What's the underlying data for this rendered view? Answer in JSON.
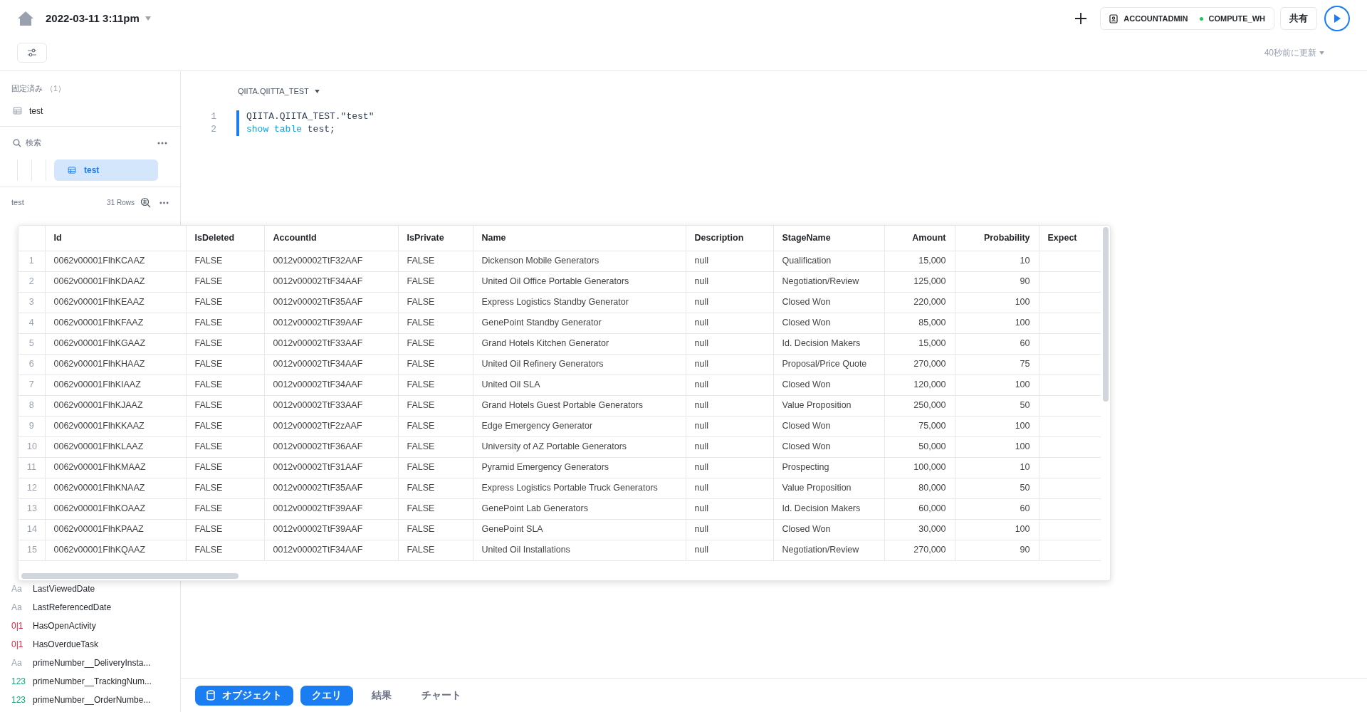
{
  "header": {
    "title": "2022-03-11 3:11pm",
    "role": "ACCOUNTADMIN",
    "warehouse": "COMPUTE_WH",
    "share": "共有",
    "updated": "40秒前に更新"
  },
  "sidebar": {
    "pinned_label": "固定済み",
    "pinned_count": "（1）",
    "pinned_items": [
      "test"
    ],
    "search": "検索",
    "tree": [
      {
        "label": "test",
        "selected": true
      }
    ],
    "table_name": "test",
    "row_count": "31 Rows",
    "columns": [
      {
        "kind": "text",
        "type_label": "Aa",
        "name": "LastViewedDate"
      },
      {
        "kind": "text",
        "type_label": "Aa",
        "name": "LastReferencedDate"
      },
      {
        "kind": "boolean",
        "type_label": "0|1",
        "name": "HasOpenActivity"
      },
      {
        "kind": "boolean",
        "type_label": "0|1",
        "name": "HasOverdueTask"
      },
      {
        "kind": "text",
        "type_label": "Aa",
        "name": "primeNumber__DeliveryInsta..."
      },
      {
        "kind": "number",
        "type_label": "123",
        "name": "primeNumber__TrackingNum..."
      },
      {
        "kind": "number",
        "type_label": "123",
        "name": "primeNumber__OrderNumbe..."
      }
    ]
  },
  "editor": {
    "schema": "QIITA.QIITTA_TEST",
    "lines": [
      {
        "number": "1",
        "tokens": [
          {
            "kind": "plain",
            "text": "QIITA.QIITA_TEST.\"test\""
          }
        ]
      },
      {
        "number": "2",
        "tokens": [
          {
            "kind": "keyword",
            "text": "show table"
          },
          {
            "kind": "plain",
            "text": " test;"
          }
        ]
      }
    ]
  },
  "table": {
    "columns": [
      {
        "kind": "index"
      },
      {
        "label": "Id",
        "kind": "text"
      },
      {
        "label": "IsDeleted",
        "kind": "text"
      },
      {
        "label": "AccountId",
        "kind": "text"
      },
      {
        "label": "IsPrivate",
        "kind": "text"
      },
      {
        "label": "Name",
        "kind": "text"
      },
      {
        "label": "Description",
        "kind": "text"
      },
      {
        "label": "StageName",
        "kind": "text"
      },
      {
        "label": "Amount",
        "kind": "number"
      },
      {
        "label": "Probability",
        "kind": "number"
      },
      {
        "label": "Expect",
        "kind": "text"
      }
    ],
    "rows": [
      [
        "1",
        "0062v00001FlhKCAAZ",
        "FALSE",
        "0012v00002TtF32AAF",
        "FALSE",
        "Dickenson Mobile Generators",
        "null",
        "Qualification",
        "15,000",
        "10"
      ],
      [
        "2",
        "0062v00001FlhKDAAZ",
        "FALSE",
        "0012v00002TtF34AAF",
        "FALSE",
        "United Oil Office Portable Generators",
        "null",
        "Negotiation/Review",
        "125,000",
        "90"
      ],
      [
        "3",
        "0062v00001FlhKEAAZ",
        "FALSE",
        "0012v00002TtF35AAF",
        "FALSE",
        "Express Logistics Standby Generator",
        "null",
        "Closed Won",
        "220,000",
        "100"
      ],
      [
        "4",
        "0062v00001FlhKFAAZ",
        "FALSE",
        "0012v00002TtF39AAF",
        "FALSE",
        "GenePoint Standby Generator",
        "null",
        "Closed Won",
        "85,000",
        "100"
      ],
      [
        "5",
        "0062v00001FlhKGAAZ",
        "FALSE",
        "0012v00002TtF33AAF",
        "FALSE",
        "Grand Hotels Kitchen Generator",
        "null",
        "Id. Decision Makers",
        "15,000",
        "60"
      ],
      [
        "6",
        "0062v00001FlhKHAAZ",
        "FALSE",
        "0012v00002TtF34AAF",
        "FALSE",
        "United Oil Refinery Generators",
        "null",
        "Proposal/Price Quote",
        "270,000",
        "75"
      ],
      [
        "7",
        "0062v00001FlhKIAAZ",
        "FALSE",
        "0012v00002TtF34AAF",
        "FALSE",
        "United Oil SLA",
        "null",
        "Closed Won",
        "120,000",
        "100"
      ],
      [
        "8",
        "0062v00001FlhKJAAZ",
        "FALSE",
        "0012v00002TtF33AAF",
        "FALSE",
        "Grand Hotels Guest Portable Generators",
        "null",
        "Value Proposition",
        "250,000",
        "50"
      ],
      [
        "9",
        "0062v00001FlhKKAAZ",
        "FALSE",
        "0012v00002TtF2zAAF",
        "FALSE",
        "Edge Emergency Generator",
        "null",
        "Closed Won",
        "75,000",
        "100"
      ],
      [
        "10",
        "0062v00001FlhKLAAZ",
        "FALSE",
        "0012v00002TtF36AAF",
        "FALSE",
        "University of AZ Portable Generators",
        "null",
        "Closed Won",
        "50,000",
        "100"
      ],
      [
        "11",
        "0062v00001FlhKMAAZ",
        "FALSE",
        "0012v00002TtF31AAF",
        "FALSE",
        "Pyramid Emergency Generators",
        "null",
        "Prospecting",
        "100,000",
        "10"
      ],
      [
        "12",
        "0062v00001FlhKNAAZ",
        "FALSE",
        "0012v00002TtF35AAF",
        "FALSE",
        "Express Logistics Portable Truck Generators",
        "null",
        "Value Proposition",
        "80,000",
        "50"
      ],
      [
        "13",
        "0062v00001FlhKOAAZ",
        "FALSE",
        "0012v00002TtF39AAF",
        "FALSE",
        "GenePoint Lab Generators",
        "null",
        "Id. Decision Makers",
        "60,000",
        "60"
      ],
      [
        "14",
        "0062v00001FlhKPAAZ",
        "FALSE",
        "0012v00002TtF39AAF",
        "FALSE",
        "GenePoint SLA",
        "null",
        "Closed Won",
        "30,000",
        "100"
      ],
      [
        "15",
        "0062v00001FlhKQAAZ",
        "FALSE",
        "0012v00002TtF34AAF",
        "FALSE",
        "United Oil Installations",
        "null",
        "Negotiation/Review",
        "270,000",
        "90"
      ]
    ]
  },
  "bottom_tabs": [
    {
      "label": "オブジェクト",
      "on": true,
      "icon": true
    },
    {
      "label": "クエリ",
      "on": true,
      "icon": false
    },
    {
      "label": "結果",
      "on": false,
      "icon": false
    },
    {
      "label": "チャート",
      "on": false,
      "icon": false
    }
  ]
}
